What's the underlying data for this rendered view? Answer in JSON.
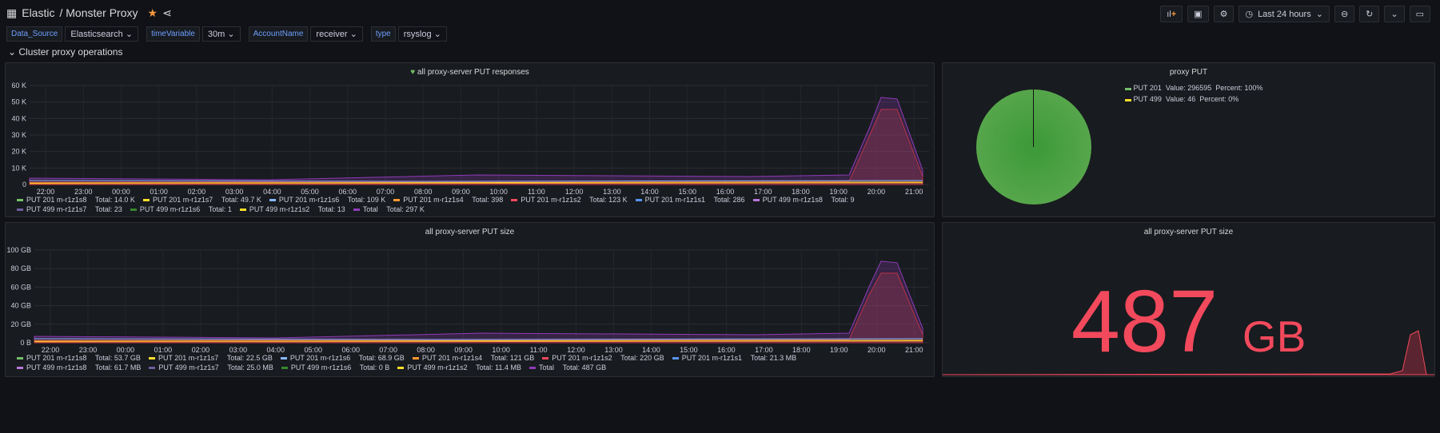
{
  "header": {
    "org": "Elastic",
    "title": "/ Monster Proxy",
    "time_range": "Last 24 hours"
  },
  "variables": [
    {
      "label": "Data_Source",
      "value": "Elasticsearch"
    },
    {
      "label": "timeVariable",
      "value": "30m"
    },
    {
      "label": "AccountName",
      "value": "receiver"
    },
    {
      "label": "type",
      "value": "rsyslog"
    }
  ],
  "row_title": "Cluster proxy operations",
  "panels": {
    "responses": {
      "title": "all proxy-server PUT responses",
      "yticks": [
        "60 K",
        "50 K",
        "40 K",
        "30 K",
        "20 K",
        "10 K",
        "0"
      ],
      "legend": [
        {
          "name": "PUT 201 m-r1z1s8",
          "total": "Total: 14.0 K",
          "color": "#73bf69"
        },
        {
          "name": "PUT 201 m-r1z1s7",
          "total": "Total: 49.7 K",
          "color": "#fade2a"
        },
        {
          "name": "PUT 201 m-r1z1s6",
          "total": "Total: 109 K",
          "color": "#8ab8ff"
        },
        {
          "name": "PUT 201 m-r1z1s4",
          "total": "Total: 398",
          "color": "#ff9830"
        },
        {
          "name": "PUT 201 m-r1z1s2",
          "total": "Total: 123 K",
          "color": "#f2495c"
        },
        {
          "name": "PUT 201 m-r1z1s1",
          "total": "Total: 286",
          "color": "#5794f2"
        },
        {
          "name": "PUT 499 m-r1z1s8",
          "total": "Total: 9",
          "color": "#b877d9"
        },
        {
          "name": "PUT 499 m-r1z1s7",
          "total": "Total: 23",
          "color": "#705da0"
        },
        {
          "name": "PUT 499 m-r1z1s6",
          "total": "Total: 1",
          "color": "#37872d"
        },
        {
          "name": "PUT 499 m-r1z1s2",
          "total": "Total: 13",
          "color": "#fade2a"
        },
        {
          "name": "Total",
          "total": "Total: 297 K",
          "color": "#8f3bb8"
        }
      ]
    },
    "pie": {
      "title": "proxy PUT",
      "legend": [
        {
          "name": "PUT 201",
          "value": "Value: 296595",
          "percent": "Percent: 100%",
          "color": "#73bf69"
        },
        {
          "name": "PUT 499",
          "value": "Value: 46",
          "percent": "Percent: 0%",
          "color": "#fade2a"
        }
      ]
    },
    "size": {
      "title": "all proxy-server PUT size",
      "yticks": [
        "100 GB",
        "80 GB",
        "60 GB",
        "40 GB",
        "20 GB",
        "0 B"
      ],
      "legend": [
        {
          "name": "PUT 201 m-r1z1s8",
          "total": "Total: 53.7 GB",
          "color": "#73bf69"
        },
        {
          "name": "PUT 201 m-r1z1s7",
          "total": "Total: 22.5 GB",
          "color": "#fade2a"
        },
        {
          "name": "PUT 201 m-r1z1s6",
          "total": "Total: 68.9 GB",
          "color": "#8ab8ff"
        },
        {
          "name": "PUT 201 m-r1z1s4",
          "total": "Total: 121 GB",
          "color": "#ff9830"
        },
        {
          "name": "PUT 201 m-r1z1s2",
          "total": "Total: 220 GB",
          "color": "#f2495c"
        },
        {
          "name": "PUT 201 m-r1z1s1",
          "total": "Total: 21.3 MB",
          "color": "#5794f2"
        },
        {
          "name": "PUT 499 m-r1z1s8",
          "total": "Total: 61.7 MB",
          "color": "#b877d9"
        },
        {
          "name": "PUT 499 m-r1z1s7",
          "total": "Total: 25.0 MB",
          "color": "#705da0"
        },
        {
          "name": "PUT 499 m-r1z1s6",
          "total": "Total: 0 B",
          "color": "#37872d"
        },
        {
          "name": "PUT 499 m-r1z1s2",
          "total": "Total: 11.4 MB",
          "color": "#fade2a"
        },
        {
          "name": "Total",
          "total": "Total: 487 GB",
          "color": "#8f3bb8"
        }
      ]
    },
    "stat": {
      "title": "all proxy-server PUT size",
      "value": "487",
      "unit": "GB"
    }
  },
  "xticks": [
    "22:00",
    "23:00",
    "00:00",
    "01:00",
    "02:00",
    "03:00",
    "04:00",
    "05:00",
    "06:00",
    "07:00",
    "08:00",
    "09:00",
    "10:00",
    "11:00",
    "12:00",
    "13:00",
    "14:00",
    "15:00",
    "16:00",
    "17:00",
    "18:00",
    "19:00",
    "20:00",
    "21:00"
  ]
}
